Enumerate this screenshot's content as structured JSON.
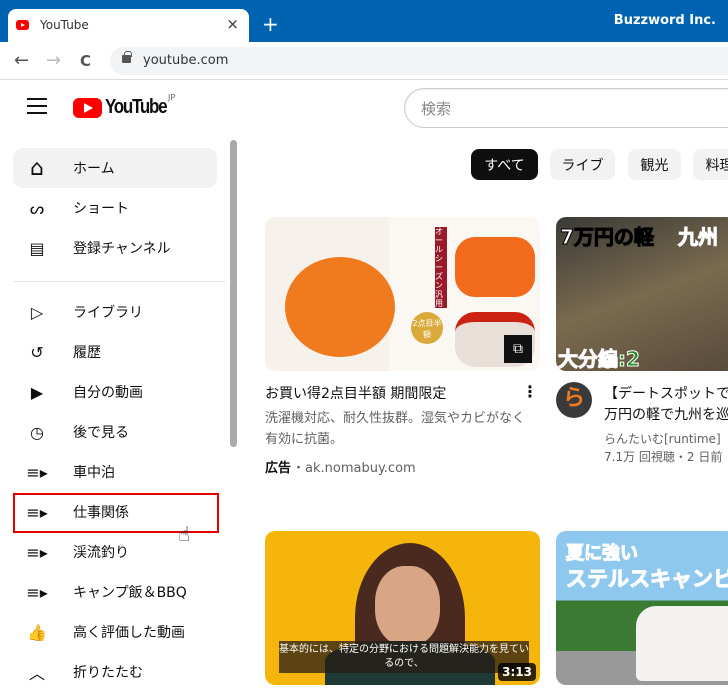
{
  "browser": {
    "tab_title": "YouTube",
    "close": "×",
    "new_tab": "+",
    "org": "Buzzword Inc.",
    "url": "youtube.com",
    "back": "←",
    "forward": "→",
    "reload": "C"
  },
  "header": {
    "logo": "YouTube",
    "region": "JP",
    "search_placeholder": "検索"
  },
  "sidebar": {
    "items": [
      {
        "label": "ホーム",
        "icon": "home-icon",
        "glyph": "⌂"
      },
      {
        "label": "ショート",
        "icon": "shorts-icon",
        "glyph": "ᔕ"
      },
      {
        "label": "登録チャンネル",
        "icon": "subscriptions-icon",
        "glyph": "▤"
      },
      {
        "label": "ライブラリ",
        "icon": "library-icon",
        "glyph": "▷"
      },
      {
        "label": "履歴",
        "icon": "history-icon",
        "glyph": "↺"
      },
      {
        "label": "自分の動画",
        "icon": "my-videos-icon",
        "glyph": "▶"
      },
      {
        "label": "後で見る",
        "icon": "watch-later-icon",
        "glyph": "◷"
      },
      {
        "label": "車中泊",
        "icon": "playlist-icon",
        "glyph": "≡▸"
      },
      {
        "label": "仕事関係",
        "icon": "playlist-icon",
        "glyph": "≡▸"
      },
      {
        "label": "渓流釣り",
        "icon": "playlist-icon",
        "glyph": "≡▸"
      },
      {
        "label": "キャンプ飯＆BBQ",
        "icon": "playlist-icon",
        "glyph": "≡▸"
      },
      {
        "label": "高く評価した動画",
        "icon": "thumbs-up-icon",
        "glyph": "👍"
      },
      {
        "label": "折りたたむ",
        "icon": "chevron-up-icon",
        "glyph": "︿"
      }
    ],
    "active": "ホーム",
    "highlighted": "仕事関係"
  },
  "chips": [
    "すべて",
    "ライブ",
    "観光",
    "料理"
  ],
  "videos": [
    {
      "title": "お買い得2点目半額 期間限定",
      "desc": "洗濯機対応、耐久性抜群。湿気やカビがなく有効に抗菌。",
      "ad_label": "広告",
      "domain": "ak.nomabuy.com",
      "thumb_text": [
        "オールシーズン汎用",
        "2点目半額"
      ]
    },
    {
      "title": "【デートスポットで",
      "title2": "万円の軽で九州を巡",
      "channel": "らんたいむ[runtime]",
      "meta": "7.1万 回視聴・2 日前",
      "avatar": "ら",
      "thumb_text": [
        "7万円の軽",
        "九州",
        "大分編:2"
      ]
    },
    {
      "duration": "3:13",
      "subtitle": "基本的には、特定の分野における問題解決能力を見ているので、"
    },
    {
      "thumb_text": [
        "夏に強い",
        "ステルスキャンピ"
      ]
    }
  ],
  "colors": {
    "browser": "#0063b1",
    "accent": "#ff0000",
    "highlight_box": "#e60000"
  }
}
